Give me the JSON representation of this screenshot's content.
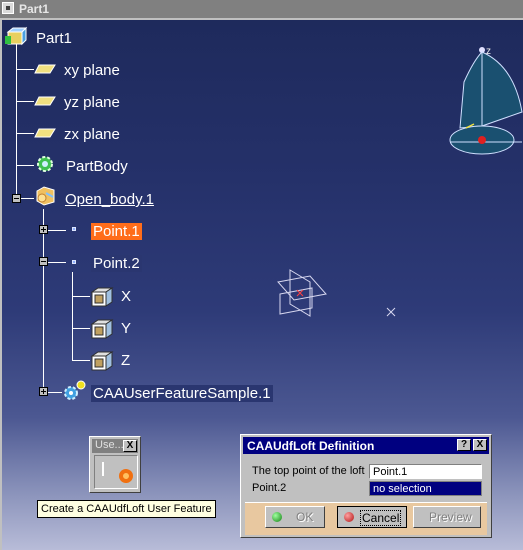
{
  "window": {
    "title": "Part1"
  },
  "tree": {
    "root": "Part1",
    "xy_plane": "xy plane",
    "yz_plane": "yz plane",
    "zx_plane": "zx plane",
    "part_body": "PartBody",
    "open_body": "Open_body.1",
    "point1": "Point.1",
    "point2": "Point.2",
    "x": "X",
    "y": "Y",
    "z": "Z",
    "udf": "CAAUserFeatureSample.1"
  },
  "compass": {
    "z_label": "z"
  },
  "toolbar": {
    "title": "Use...",
    "close": "X"
  },
  "tooltip": "Create a CAAUdfLoft User Feature",
  "dialog": {
    "title": "CAAUdfLoft Definition",
    "help": "?",
    "close": "X",
    "label1": "The top point of the loft",
    "value1": "Point.1",
    "label2": "Point.2",
    "value2": "no selection",
    "ok": "OK",
    "cancel": "Cancel",
    "preview": "Preview"
  },
  "colors": {
    "selection": "#ff6d1a",
    "dialog_title": "#000080",
    "viewport_top": "#1e2a5c"
  }
}
